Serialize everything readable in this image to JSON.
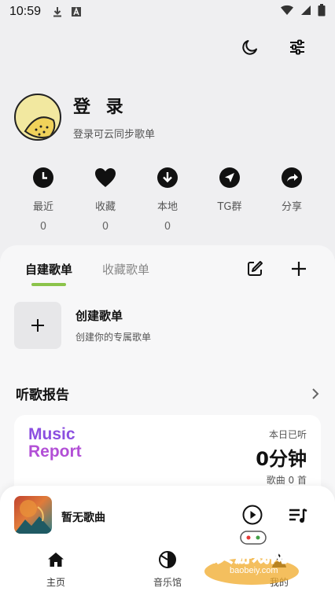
{
  "status_bar": {
    "time": "10:59"
  },
  "profile": {
    "name": "登 录",
    "subtitle": "登录可云同步歌单"
  },
  "quick_actions": [
    {
      "label": "最近",
      "count": "0",
      "icon": "clock-icon"
    },
    {
      "label": "收藏",
      "count": "0",
      "icon": "heart-icon"
    },
    {
      "label": "本地",
      "count": "0",
      "icon": "download-icon"
    },
    {
      "label": "TG群",
      "count": "",
      "icon": "telegram-icon"
    },
    {
      "label": "分享",
      "count": "",
      "icon": "share-icon"
    }
  ],
  "tabs": {
    "created": "自建歌单",
    "collected": "收藏歌单"
  },
  "create_playlist": {
    "title": "创建歌单",
    "subtitle": "创建你的专属歌单"
  },
  "report": {
    "section_title": "听歌报告",
    "logo_line1": "Music",
    "logo_line2": "Report",
    "today_label": "本日已听",
    "minutes": "0分钟",
    "songs": "歌曲 0 首"
  },
  "player": {
    "song": "暂无歌曲"
  },
  "bottom_nav": {
    "home": "主页",
    "music_hall": "音乐馆",
    "third": "我的"
  },
  "watermark": {
    "text": "宝贝游戏网",
    "url": "baobeiy.com"
  },
  "colors": {
    "accent": "#8bc34a",
    "report_logo": "#8b4fe0"
  }
}
